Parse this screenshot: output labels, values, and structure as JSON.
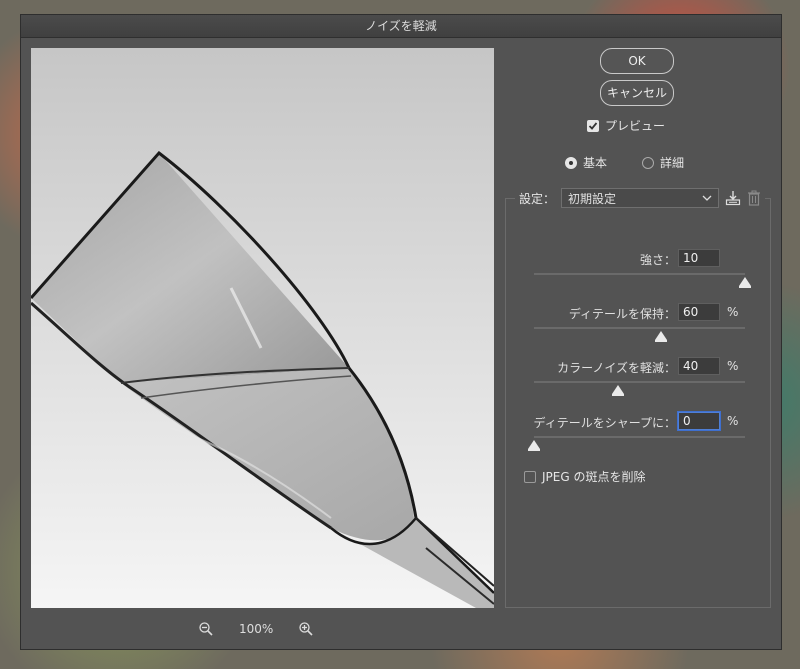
{
  "window": {
    "title": "ノイズを軽減"
  },
  "buttons": {
    "ok": "OK",
    "cancel": "キャンセル"
  },
  "preview_toggle": {
    "label": "プレビュー",
    "checked": true
  },
  "mode": {
    "basic": {
      "label": "基本",
      "selected": true
    },
    "advanced": {
      "label": "詳細",
      "selected": false
    }
  },
  "settings": {
    "label": "設定：",
    "preset": "初期設定",
    "save_icon": "save-preset-icon",
    "delete_icon": "trash-icon"
  },
  "params": {
    "strength": {
      "label": "強さ：",
      "value": "10",
      "unit": "",
      "level": 10,
      "max": 10
    },
    "preserve_details": {
      "label": "ディテールを保持：",
      "value": "60",
      "unit": "%",
      "level": 60,
      "max": 100
    },
    "reduce_color_noise": {
      "label": "カラーノイズを軽減：",
      "value": "40",
      "unit": "%",
      "level": 40,
      "max": 100
    },
    "sharpen_details": {
      "label": "ディテールをシャープに：",
      "value": "0",
      "unit": "%",
      "level": 0,
      "max": 100
    }
  },
  "jpeg_artifact": {
    "label": "JPEG の斑点を削除",
    "checked": false
  },
  "zoom": {
    "level": "100%",
    "zoom_out_icon": "zoom-out-icon",
    "zoom_in_icon": "zoom-in-icon"
  }
}
